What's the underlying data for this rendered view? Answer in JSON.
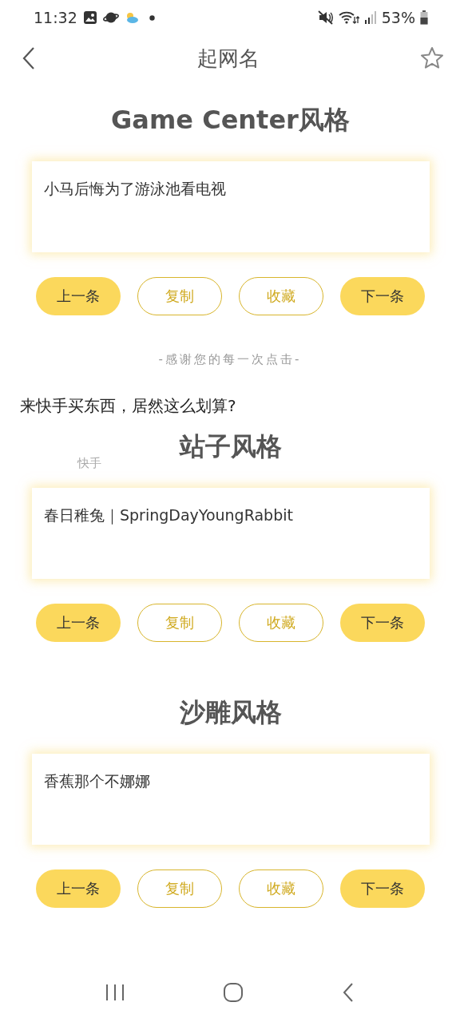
{
  "status_bar": {
    "time": "11:32",
    "battery": "53%"
  },
  "header": {
    "title": "起网名"
  },
  "sections": [
    {
      "title": "Game Center风格",
      "text": "小马后悔为了游泳池看电视",
      "buttons": [
        {
          "label": "上一条",
          "kind": "filled"
        },
        {
          "label": "复制",
          "kind": "outline"
        },
        {
          "label": "收藏",
          "kind": "outline"
        },
        {
          "label": "下一条",
          "kind": "filled"
        }
      ]
    },
    {
      "title": "站子风格",
      "text": "春日稚兔｜SpringDayYoungRabbit",
      "buttons": [
        {
          "label": "上一条",
          "kind": "filled"
        },
        {
          "label": "复制",
          "kind": "outline"
        },
        {
          "label": "收藏",
          "kind": "outline"
        },
        {
          "label": "下一条",
          "kind": "filled"
        }
      ]
    },
    {
      "title": "沙雕风格",
      "text": "香蕉那个不娜娜",
      "buttons": [
        {
          "label": "上一条",
          "kind": "filled"
        },
        {
          "label": "复制",
          "kind": "outline"
        },
        {
          "label": "收藏",
          "kind": "outline"
        },
        {
          "label": "下一条",
          "kind": "filled"
        }
      ]
    }
  ],
  "thanks_note": "-感谢您的每一次点击-",
  "ad": {
    "headline": "来快手买东西，居然这么划算?",
    "source": "快手"
  }
}
